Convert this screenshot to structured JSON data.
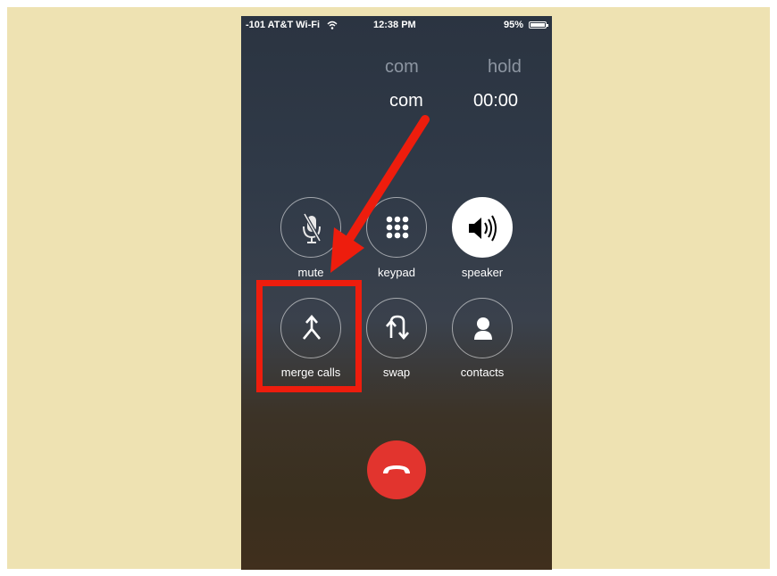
{
  "status_bar": {
    "carrier": "-101 AT&T Wi-Fi",
    "time": "12:38 PM",
    "battery": "95%"
  },
  "calls": {
    "held": {
      "name": "com",
      "status": "hold"
    },
    "active": {
      "name": "com",
      "duration": "00:00"
    }
  },
  "controls": {
    "mute": "mute",
    "keypad": "keypad",
    "speaker": "speaker",
    "merge_calls": "merge calls",
    "swap": "swap",
    "contacts": "contacts"
  },
  "colors": {
    "background": "#eee2b2",
    "end_call": "#e2342e",
    "annotation": "#ee1d0d"
  },
  "icons": [
    "wifi-icon",
    "battery-icon",
    "mute-mic-icon",
    "keypad-icon",
    "speaker-icon",
    "merge-icon",
    "swap-icon",
    "contacts-icon",
    "end-call-icon",
    "annotation-arrow"
  ]
}
